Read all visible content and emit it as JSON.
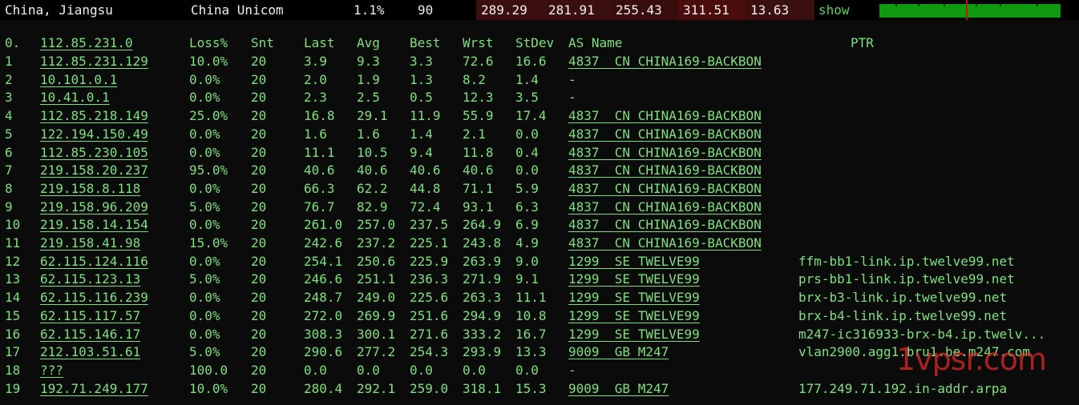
{
  "header": {
    "location": "China, Jiangsu",
    "isp": "China Unicom",
    "loss": "1.1%",
    "sent": "90",
    "last": "289.29",
    "avg": "281.91",
    "best": "255.43",
    "worst": "311.51",
    "stdev": "13.63",
    "show_label": "show",
    "graph_color": "#0f9a0f",
    "graph_marker_color": "#d01010"
  },
  "table": {
    "columns": {
      "idx": "0.",
      "host": "112.85.231.0",
      "loss": "Loss%",
      "snt": "Snt",
      "last": "Last",
      "avg": "Avg",
      "best": "Best",
      "wrst": "Wrst",
      "stdev": "StDev",
      "as": "AS Name",
      "ptr": "PTR"
    },
    "rows": [
      {
        "idx": "1",
        "host": "112.85.231.129",
        "loss": "10.0%",
        "snt": "20",
        "last": "3.9",
        "avg": "9.3",
        "best": "3.3",
        "wrst": "72.6",
        "stdev": "16.6",
        "as": "4837  CN CHINA169-BACKBON",
        "ptr": ""
      },
      {
        "idx": "2",
        "host": "10.101.0.1",
        "loss": "0.0%",
        "snt": "20",
        "last": "2.0",
        "avg": "1.9",
        "best": "1.3",
        "wrst": "8.2",
        "stdev": "1.4",
        "as": "-",
        "ptr": ""
      },
      {
        "idx": "3",
        "host": "10.41.0.1",
        "loss": "0.0%",
        "snt": "20",
        "last": "2.3",
        "avg": "2.5",
        "best": "0.5",
        "wrst": "12.3",
        "stdev": "3.5",
        "as": "-",
        "ptr": ""
      },
      {
        "idx": "4",
        "host": "112.85.218.149",
        "loss": "25.0%",
        "snt": "20",
        "last": "16.8",
        "avg": "29.1",
        "best": "11.9",
        "wrst": "55.9",
        "stdev": "17.4",
        "as": "4837  CN CHINA169-BACKBON",
        "ptr": ""
      },
      {
        "idx": "5",
        "host": "122.194.150.49",
        "loss": "0.0%",
        "snt": "20",
        "last": "1.6",
        "avg": "1.6",
        "best": "1.4",
        "wrst": "2.1",
        "stdev": "0.0",
        "as": "4837  CN CHINA169-BACKBON",
        "ptr": ""
      },
      {
        "idx": "6",
        "host": "112.85.230.105",
        "loss": "0.0%",
        "snt": "20",
        "last": "11.1",
        "avg": "10.5",
        "best": "9.4",
        "wrst": "11.8",
        "stdev": "0.4",
        "as": "4837  CN CHINA169-BACKBON",
        "ptr": ""
      },
      {
        "idx": "7",
        "host": "219.158.20.237",
        "loss": "95.0%",
        "snt": "20",
        "last": "40.6",
        "avg": "40.6",
        "best": "40.6",
        "wrst": "40.6",
        "stdev": "0.0",
        "as": "4837  CN CHINA169-BACKBON",
        "ptr": ""
      },
      {
        "idx": "8",
        "host": "219.158.8.118",
        "loss": "0.0%",
        "snt": "20",
        "last": "66.3",
        "avg": "62.2",
        "best": "44.8",
        "wrst": "71.1",
        "stdev": "5.9",
        "as": "4837  CN CHINA169-BACKBON",
        "ptr": ""
      },
      {
        "idx": "9",
        "host": "219.158.96.209",
        "loss": "5.0%",
        "snt": "20",
        "last": "76.7",
        "avg": "82.9",
        "best": "72.4",
        "wrst": "93.1",
        "stdev": "6.3",
        "as": "4837  CN CHINA169-BACKBON",
        "ptr": ""
      },
      {
        "idx": "10",
        "host": "219.158.14.154",
        "loss": "0.0%",
        "snt": "20",
        "last": "261.0",
        "avg": "257.0",
        "best": "237.5",
        "wrst": "264.9",
        "stdev": "6.9",
        "as": "4837  CN CHINA169-BACKBON",
        "ptr": ""
      },
      {
        "idx": "11",
        "host": "219.158.41.98",
        "loss": "15.0%",
        "snt": "20",
        "last": "242.6",
        "avg": "237.2",
        "best": "225.1",
        "wrst": "243.8",
        "stdev": "4.9",
        "as": "4837  CN CHINA169-BACKBON",
        "ptr": ""
      },
      {
        "idx": "12",
        "host": "62.115.124.116",
        "loss": "0.0%",
        "snt": "20",
        "last": "254.1",
        "avg": "250.6",
        "best": "225.9",
        "wrst": "263.9",
        "stdev": "9.0",
        "as": "1299  SE TWELVE99",
        "ptr": "ffm-bb1-link.ip.twelve99.net"
      },
      {
        "idx": "13",
        "host": "62.115.123.13",
        "loss": "5.0%",
        "snt": "20",
        "last": "246.6",
        "avg": "251.1",
        "best": "236.3",
        "wrst": "271.9",
        "stdev": "9.1",
        "as": "1299  SE TWELVE99",
        "ptr": "prs-bb1-link.ip.twelve99.net"
      },
      {
        "idx": "14",
        "host": "62.115.116.239",
        "loss": "0.0%",
        "snt": "20",
        "last": "248.7",
        "avg": "249.0",
        "best": "225.6",
        "wrst": "263.3",
        "stdev": "11.1",
        "as": "1299  SE TWELVE99",
        "ptr": "brx-b3-link.ip.twelve99.net"
      },
      {
        "idx": "15",
        "host": "62.115.117.57",
        "loss": "0.0%",
        "snt": "20",
        "last": "272.0",
        "avg": "269.9",
        "best": "251.6",
        "wrst": "294.9",
        "stdev": "10.8",
        "as": "1299  SE TWELVE99",
        "ptr": "brx-b4-link.ip.twelve99.net"
      },
      {
        "idx": "16",
        "host": "62.115.146.17",
        "loss": "0.0%",
        "snt": "20",
        "last": "308.3",
        "avg": "300.1",
        "best": "271.6",
        "wrst": "333.2",
        "stdev": "16.7",
        "as": "1299  SE TWELVE99",
        "ptr": "m247-ic316933-brx-b4.ip.twelv..."
      },
      {
        "idx": "17",
        "host": "212.103.51.61",
        "loss": "5.0%",
        "snt": "20",
        "last": "290.6",
        "avg": "277.2",
        "best": "254.3",
        "wrst": "293.9",
        "stdev": "13.3",
        "as": "9009  GB M247",
        "ptr": "vlan2900.agg1.bru1.be.m247.com"
      },
      {
        "idx": "18",
        "host": "???",
        "loss": "100.0",
        "snt": "20",
        "last": "0.0",
        "avg": "0.0",
        "best": "0.0",
        "wrst": "0.0",
        "stdev": "0.0",
        "as": "-",
        "ptr": ""
      },
      {
        "idx": "19",
        "host": "192.71.249.177",
        "loss": "10.0%",
        "snt": "20",
        "last": "280.4",
        "avg": "292.1",
        "best": "259.0",
        "wrst": "318.1",
        "stdev": "15.3",
        "as": "9009  GB M247",
        "ptr": "177.249.71.192.in-addr.arpa"
      }
    ]
  },
  "watermark": "1vpsr.com"
}
